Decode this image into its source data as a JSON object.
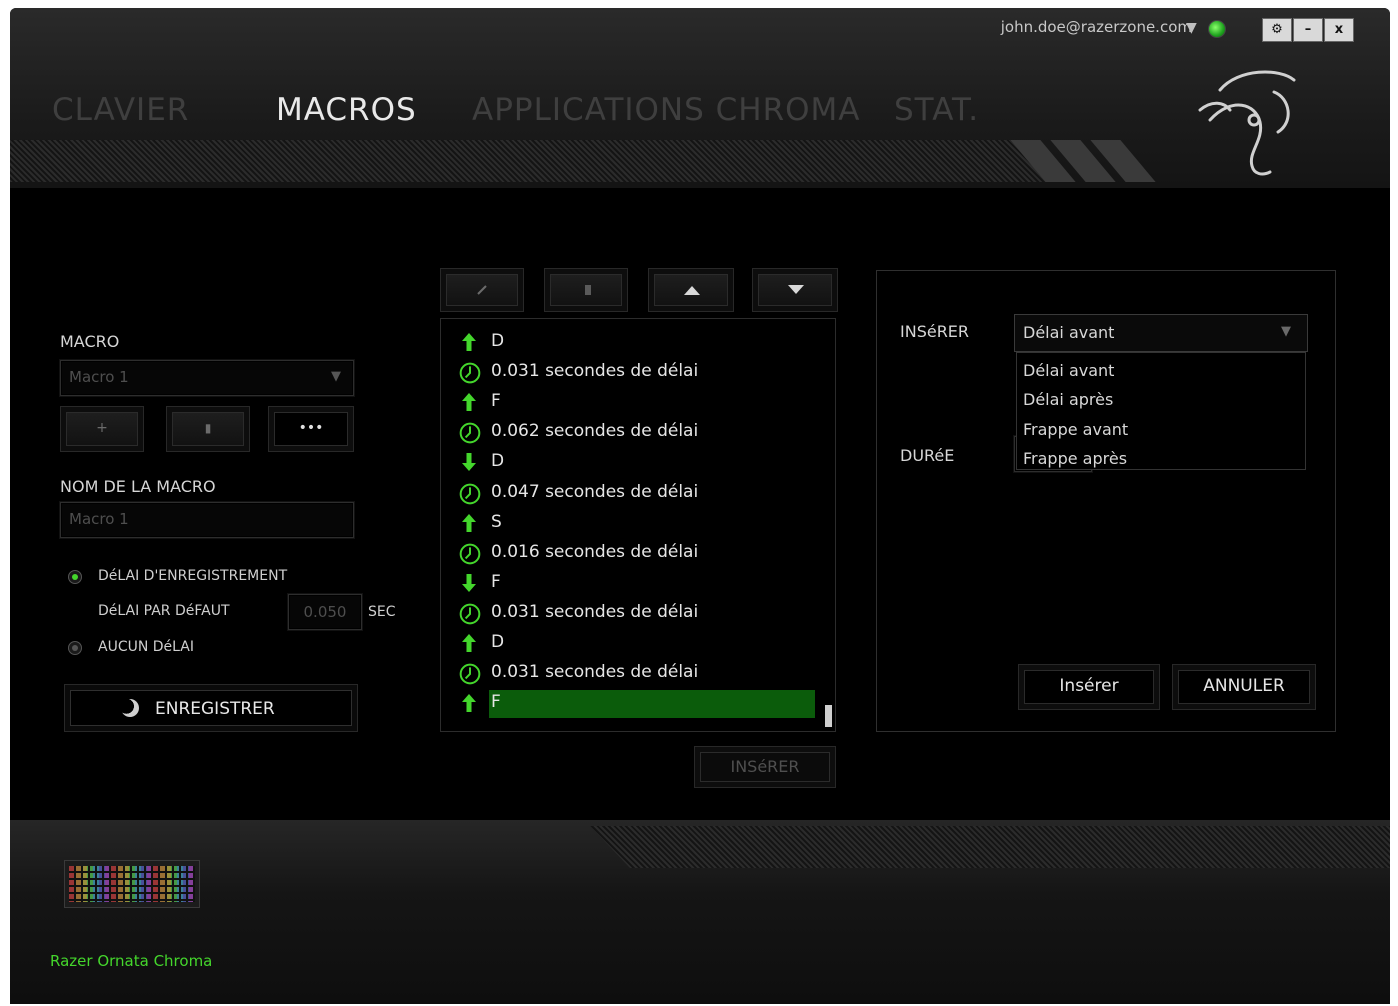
{
  "account": {
    "email": "john.doe@razerzone.com"
  },
  "window_controls": {
    "settings": "⚙",
    "minimize": "–",
    "close": "x"
  },
  "tabs": [
    {
      "label": "CLAVIER",
      "active": false
    },
    {
      "label": "MACROS",
      "active": true
    },
    {
      "label": "APPLICATIONS CHROMA",
      "active": false
    },
    {
      "label": "STAT.",
      "active": false
    }
  ],
  "macro_panel": {
    "macro_label": "MACRO",
    "macro_select_value": "Macro 1",
    "add_btn": "+",
    "delete_btn": "▮",
    "more_btn": "•••",
    "name_label": "NOM DE LA MACRO",
    "name_value": "Macro 1",
    "record_delay_label": "DéLAI D'ENREGISTREMENT",
    "default_delay_label": "DéLAI PAR DéFAUT",
    "default_delay_value": "0.050",
    "sec_label": "SEC",
    "no_delay_label": "AUCUN DéLAI",
    "record_btn": "ENREGISTRER"
  },
  "toolbar": {
    "edit_icon": "pencil-icon",
    "delete_icon": "trash-icon",
    "up_icon": "arrow-up-icon",
    "down_icon": "arrow-down-icon"
  },
  "events": [
    {
      "type": "key-up",
      "text": "D"
    },
    {
      "type": "delay",
      "text": "0.031 secondes de délai"
    },
    {
      "type": "key-up",
      "text": "F"
    },
    {
      "type": "delay",
      "text": "0.062 secondes de délai"
    },
    {
      "type": "key-down",
      "text": "D"
    },
    {
      "type": "delay",
      "text": "0.047 secondes de délai"
    },
    {
      "type": "key-up",
      "text": "S"
    },
    {
      "type": "delay",
      "text": "0.016 secondes de délai"
    },
    {
      "type": "key-down",
      "text": "F"
    },
    {
      "type": "delay",
      "text": "0.031 secondes de délai"
    },
    {
      "type": "key-up",
      "text": "D"
    },
    {
      "type": "delay",
      "text": "0.031 secondes de délai"
    },
    {
      "type": "key-up",
      "text": "F",
      "selected": true
    }
  ],
  "insert_btn": "INSéRER",
  "insert_panel": {
    "insert_label": "INSéRER",
    "insert_selected": "Délai avant",
    "insert_options": [
      "Délai avant",
      "Délai après",
      "Frappe avant",
      "Frappe après"
    ],
    "duration_label": "DURéE",
    "confirm_btn": "Insérer",
    "cancel_btn": "ANNULER"
  },
  "device": {
    "name": "Razer Ornata Chroma"
  },
  "colors": {
    "accent": "#44d62c",
    "selected_row": "#0b5c0b",
    "background": "#000000"
  }
}
